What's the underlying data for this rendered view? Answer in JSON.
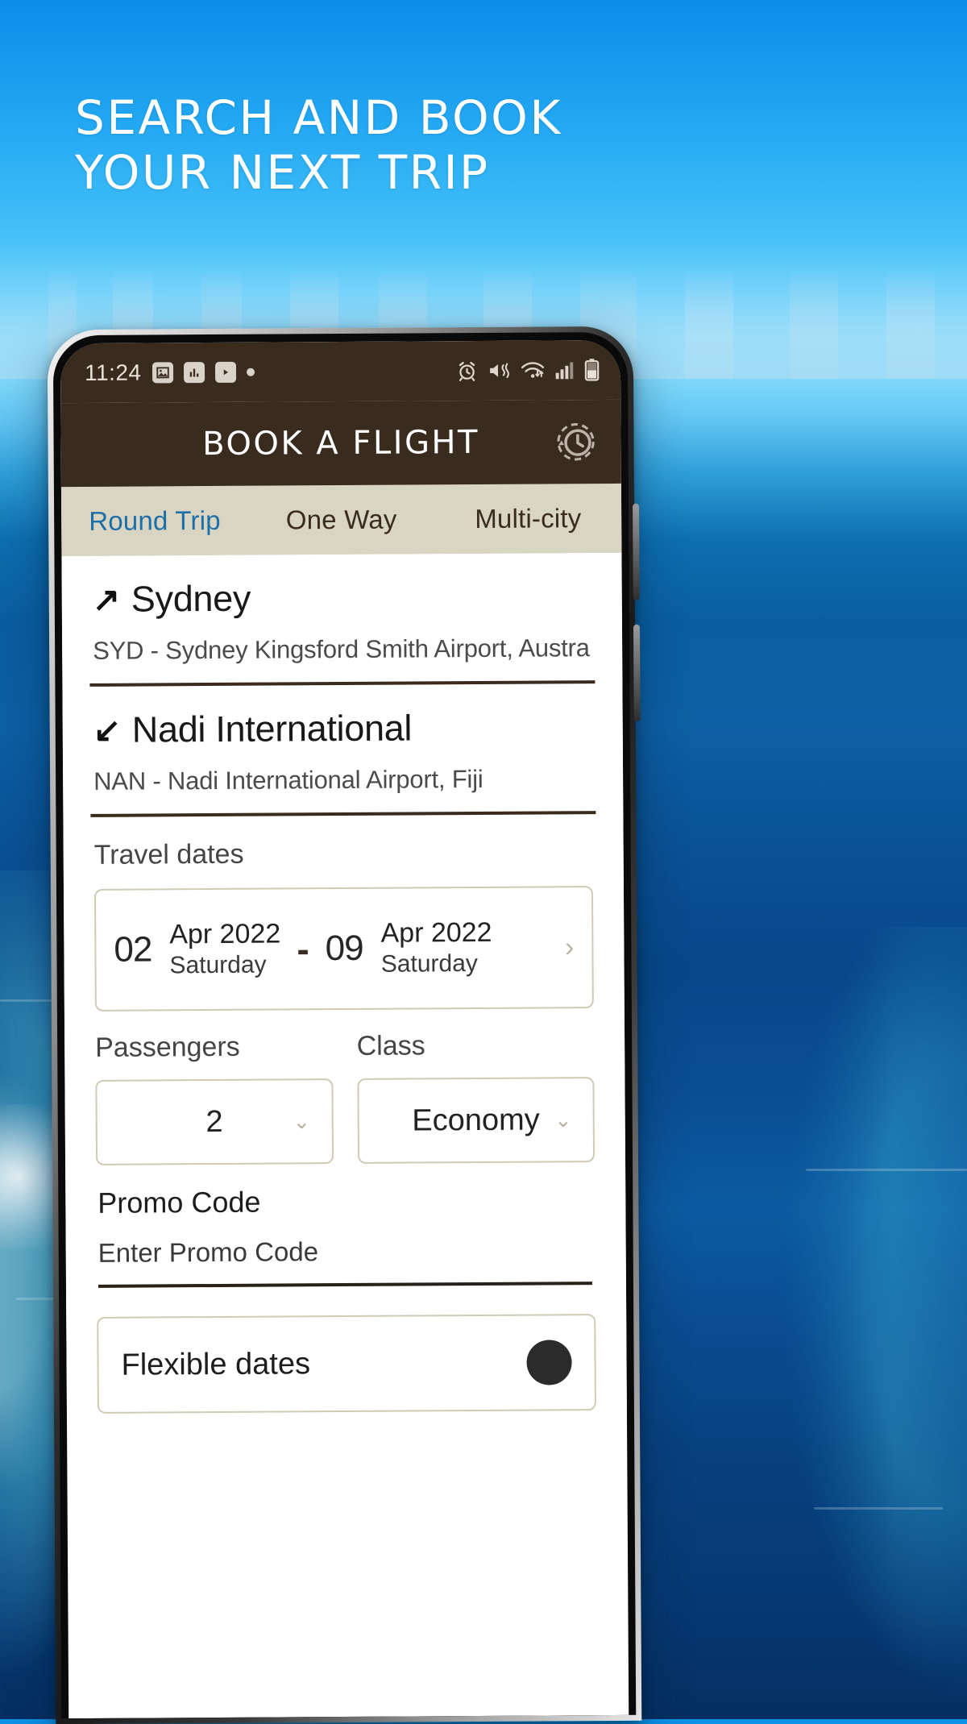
{
  "promo": {
    "headline": "SEARCH AND BOOK\nYOUR NEXT TRIP"
  },
  "phone": {
    "status_bar": {
      "time": "11:24",
      "left_icons": [
        "image-icon",
        "chart-icon",
        "youtube-play-icon",
        "dot-indicator"
      ],
      "right_icons": [
        "alarm-icon",
        "vibrate-mute-icon",
        "wifi-icon",
        "signal-bars-icon",
        "battery-icon"
      ]
    },
    "app_bar": {
      "title": "BOOK A FLIGHT",
      "history_icon": "history-clock-icon"
    },
    "tabs": [
      {
        "label": "Round Trip",
        "active": true
      },
      {
        "label": "One Way",
        "active": false
      },
      {
        "label": "Multi-city",
        "active": false
      }
    ],
    "origin": {
      "arrow": "↗",
      "city": "Sydney",
      "detail": "SYD - Sydney Kingsford Smith Airport, Austra..."
    },
    "destination": {
      "arrow": "↙",
      "city": "Nadi International",
      "detail": "NAN - Nadi International Airport, Fiji"
    },
    "travel_dates": {
      "label": "Travel dates",
      "depart": {
        "day": "02",
        "month_year": "Apr 2022",
        "weekday": "Saturday"
      },
      "separator": "-",
      "return": {
        "day": "09",
        "month_year": "Apr 2022",
        "weekday": "Saturday"
      },
      "chevron": "›"
    },
    "passengers": {
      "label": "Passengers",
      "value": "2",
      "chevron": "⌄"
    },
    "travel_class": {
      "label": "Class",
      "value": "Economy",
      "chevron": "⌄"
    },
    "promo_code": {
      "label": "Promo Code",
      "placeholder": "Enter Promo Code",
      "value": ""
    },
    "flexible_dates": {
      "label": "Flexible dates",
      "enabled": false
    }
  },
  "colors": {
    "brand_brown": "#3a2b1f",
    "tab_bar": "#d9d5c3",
    "active_tab": "#1c6ea8",
    "sky": "#1397ec",
    "sea": "#07478a"
  }
}
